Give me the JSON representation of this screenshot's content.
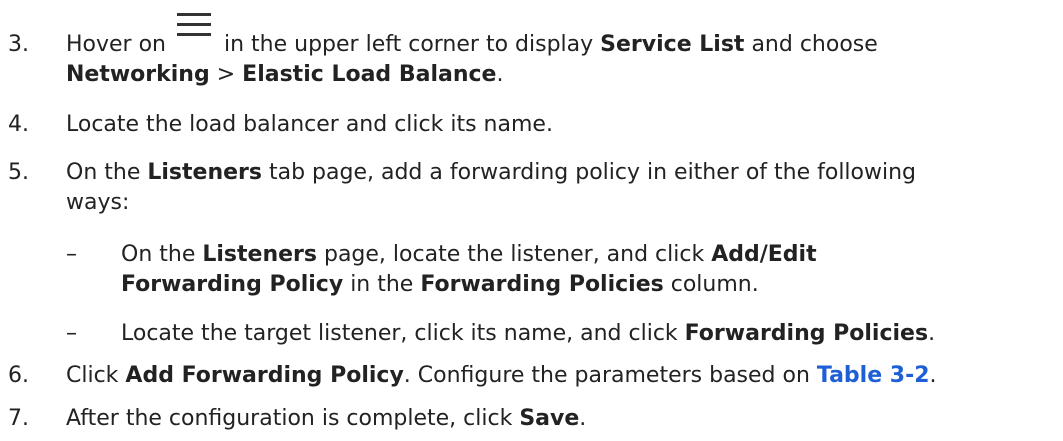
{
  "steps": [
    {
      "number": "3.",
      "hover_prefix": "Hover on",
      "hover_suffix": "in the upper left corner to display",
      "service_list": "Service List",
      "and_choose": "and choose",
      "networking": "Networking",
      "separator": ">",
      "elb": "Elastic Load Balance",
      "end": "."
    },
    {
      "number": "4.",
      "text": "Locate the load balancer and click its name."
    },
    {
      "number": "5.",
      "on_the": "On the",
      "listeners": "Listeners",
      "rest_line1": "tab page, add a forwarding policy in either of the following",
      "rest_line2": "ways:",
      "substeps": [
        {
          "dash": "–",
          "on_the": "On the",
          "listeners": "Listeners",
          "mid": "page, locate the listener, and click",
          "add_edit": "Add/Edit",
          "forwarding_policy": "Forwarding Policy",
          "in_the": "in the",
          "forwarding_policies": "Forwarding Policies",
          "column": "column."
        },
        {
          "dash": "–",
          "text": "Locate the target listener, click its name, and click",
          "forwarding_policies": "Forwarding Policies",
          "end": "."
        }
      ]
    },
    {
      "number": "6.",
      "click": "Click",
      "add_forwarding_policy": "Add Forwarding Policy",
      "mid": ". Configure the parameters based on",
      "table_link": "Table 3-2",
      "end": "."
    },
    {
      "number": "7.",
      "text": "After the configuration is complete, click",
      "save": "Save",
      "end": "."
    }
  ],
  "icons": {
    "menu": "hamburger-menu-icon"
  },
  "colors": {
    "text": "#222222",
    "link": "#1f5fd6"
  }
}
